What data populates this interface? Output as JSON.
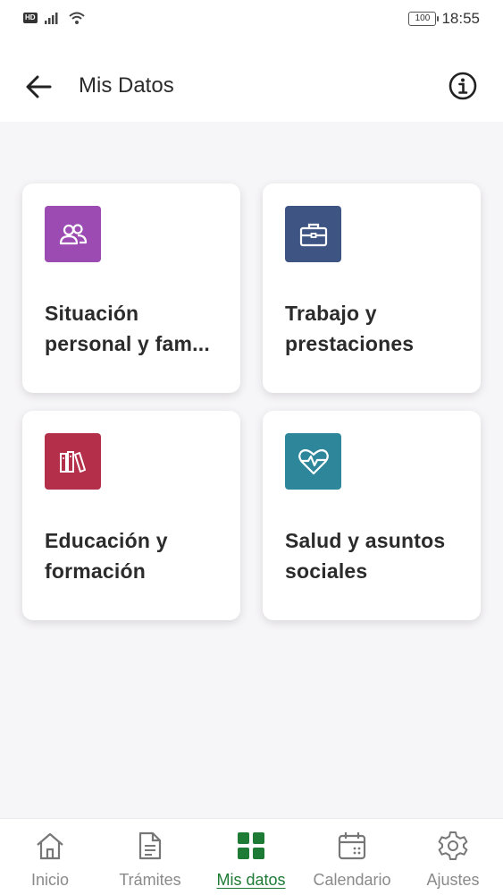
{
  "status_bar": {
    "badge": "HD",
    "battery": "100",
    "time": "18:55"
  },
  "header": {
    "title": "Mis Datos",
    "back_icon": "arrow-left-icon",
    "info_icon": "info-icon"
  },
  "cards": [
    {
      "label": "Situación personal y fam...",
      "icon": "people-icon",
      "color": "#9c4bb3"
    },
    {
      "label": "Trabajo y prestaciones",
      "icon": "briefcase-icon",
      "color": "#3e5583"
    },
    {
      "label": "Educación y formación",
      "icon": "books-icon",
      "color": "#b4304a"
    },
    {
      "label": "Salud y asuntos sociales",
      "icon": "heart-pulse-icon",
      "color": "#2e869b"
    }
  ],
  "tabs": [
    {
      "label": "Inicio",
      "icon": "home-icon"
    },
    {
      "label": "Trámites",
      "icon": "document-icon"
    },
    {
      "label": "Mis datos",
      "icon": "grid-icon",
      "active": true
    },
    {
      "label": "Calendario",
      "icon": "calendar-icon"
    },
    {
      "label": "Ajustes",
      "icon": "gear-icon"
    }
  ],
  "colors": {
    "accent": "#1e7b35",
    "background": "#f6f5f8"
  }
}
